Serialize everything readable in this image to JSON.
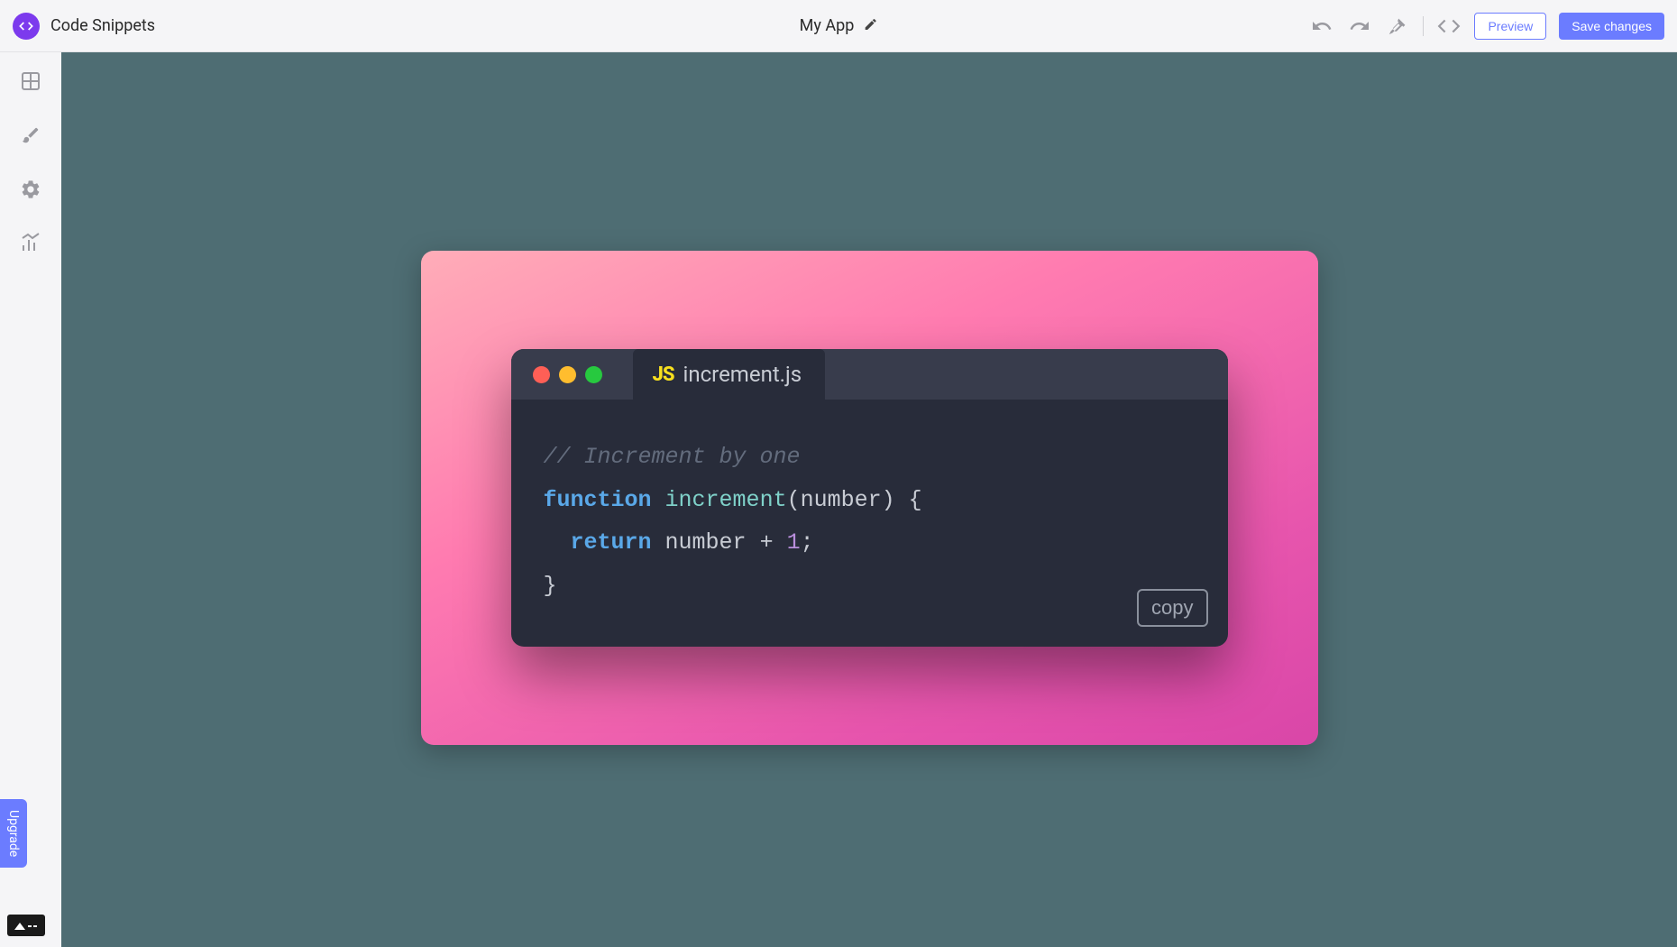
{
  "header": {
    "app_title": "Code Snippets",
    "center_title": "My App",
    "preview_label": "Preview",
    "save_label": "Save changes"
  },
  "sidebar": {
    "upgrade_label": "Upgrade"
  },
  "snippet": {
    "filename": "increment.js",
    "lang_badge": "JS",
    "copy_label": "copy",
    "code": {
      "comment": "// Increment by one",
      "kw_function": "function",
      "funcname": "increment",
      "open_paren": "(",
      "param": "number",
      "close_paren_brace": ") {",
      "kw_return": "return",
      "ret_expr_left": "number + ",
      "ret_number": "1",
      "ret_semicolon": ";",
      "close_brace": "}"
    }
  },
  "colors": {
    "accent": "#6b7cff",
    "canvas_bg": "#4e6d73",
    "editor_bg": "#282c3a",
    "gradient_start": "#ffadb8",
    "gradient_end": "#d946a8"
  }
}
